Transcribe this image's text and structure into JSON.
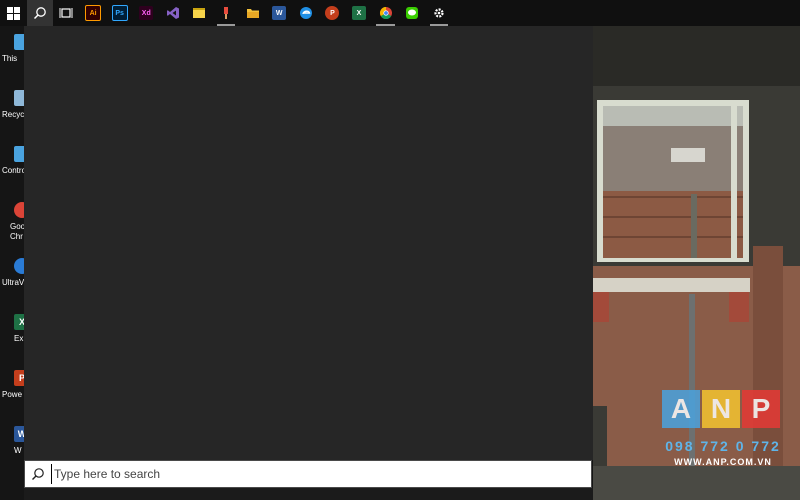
{
  "taskbar": {
    "items": [
      {
        "id": "start",
        "icon": "windows-start-icon"
      },
      {
        "id": "search",
        "icon": "search-icon",
        "active": true
      },
      {
        "id": "task-view",
        "icon": "task-view-icon"
      },
      {
        "id": "illustrator",
        "icon": "illustrator-icon",
        "label": "Ai",
        "color": "#ff9a00",
        "bg": "#330000"
      },
      {
        "id": "photoshop",
        "icon": "photoshop-icon",
        "label": "Ps",
        "color": "#31a8ff",
        "bg": "#001e36"
      },
      {
        "id": "xd",
        "icon": "xd-icon",
        "label": "Xd",
        "color": "#ff61f6",
        "bg": "#2e001e"
      },
      {
        "id": "visual-studio",
        "icon": "visual-studio-icon",
        "color": "#8661c5"
      },
      {
        "id": "sticky-notes",
        "icon": "sticky-notes-icon",
        "color": "#f7d44a"
      },
      {
        "id": "paint",
        "icon": "paint-icon",
        "running": true
      },
      {
        "id": "file-explorer",
        "icon": "folder-icon",
        "color": "#f3c13a"
      },
      {
        "id": "word",
        "icon": "word-icon",
        "label": "W",
        "color": "#ffffff",
        "bg": "#2b579a"
      },
      {
        "id": "edge",
        "icon": "edge-icon",
        "color": "#1f8fe5"
      },
      {
        "id": "powerpoint",
        "icon": "powerpoint-icon",
        "label": "P",
        "color": "#ffffff",
        "bg": "#c43e1c"
      },
      {
        "id": "excel",
        "icon": "excel-icon",
        "label": "X",
        "color": "#ffffff",
        "bg": "#1e7145"
      },
      {
        "id": "chrome",
        "icon": "chrome-icon",
        "running": true
      },
      {
        "id": "line",
        "icon": "chat-icon",
        "color": "#3acd01"
      },
      {
        "id": "settings",
        "icon": "gear-icon",
        "running": true
      }
    ]
  },
  "desktop": {
    "icons": [
      {
        "label": "This",
        "icon": "this-pc-icon",
        "color": "#4aa3df"
      },
      {
        "label": "Recyc",
        "icon": "recycle-bin-icon",
        "color": "#8fb8d8"
      },
      {
        "label": "Contro",
        "icon": "control-panel-icon",
        "color": "#4aa3df"
      },
      {
        "label": "Goo",
        "label2": "Chr",
        "icon": "chrome-icon",
        "color": "#db4437"
      },
      {
        "label": "UltraV",
        "icon": "ultraviewer-icon",
        "color": "#2a7bd5"
      },
      {
        "label": "Ex",
        "icon": "excel-icon",
        "color": "#1e7145",
        "glyph": "X"
      },
      {
        "label": "Powe",
        "icon": "powerpoint-icon",
        "color": "#c43e1c",
        "glyph": "P"
      },
      {
        "label": "W",
        "icon": "word-icon",
        "color": "#2b579a",
        "glyph": "W"
      }
    ]
  },
  "search": {
    "placeholder": "Type here to search"
  },
  "watermark": {
    "letters": [
      "A",
      "N",
      "P"
    ],
    "colors": [
      "#4aa3df",
      "#f4c430",
      "#e53935"
    ],
    "phone": "098 772 0 772",
    "url": "WWW.ANP.COM.VN"
  }
}
